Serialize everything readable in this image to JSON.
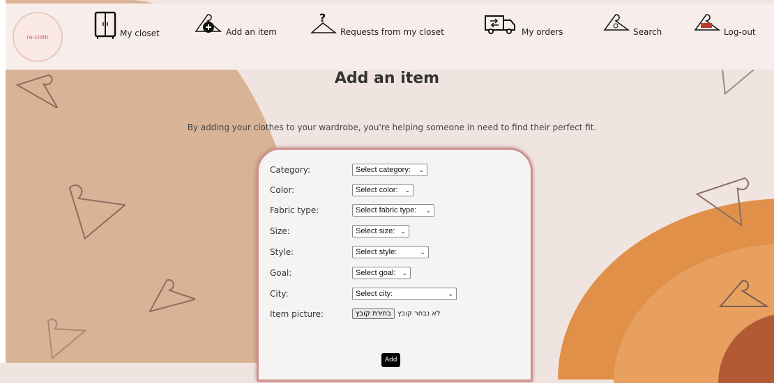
{
  "nav": {
    "logo_text": "re-cloth",
    "items": [
      {
        "label": "My closet",
        "icon": "closet-icon"
      },
      {
        "label": "Add an item",
        "icon": "hanger-plus-icon"
      },
      {
        "label": "Requests from my closet",
        "icon": "hanger-question-icon"
      },
      {
        "label": "My orders",
        "icon": "delivery-truck-icon"
      },
      {
        "label": "Search",
        "icon": "hanger-search-icon"
      },
      {
        "label": "Log-out",
        "icon": "hanger-exit-icon"
      }
    ]
  },
  "page": {
    "title": "Add an item",
    "subtitle": "By adding your clothes to your wardrobe, you're helping someone in need to find their perfect fit."
  },
  "form": {
    "category": {
      "label": "Category:",
      "value": "Select category:"
    },
    "color": {
      "label": "Color:",
      "value": "Select color:"
    },
    "fabric": {
      "label": "Fabric type:",
      "value": "Select fabric type:"
    },
    "size": {
      "label": "Size:",
      "value": "Select size:"
    },
    "style": {
      "label": "Style:",
      "value": "Select style:"
    },
    "goal": {
      "label": "Goal:",
      "value": "Select goal:"
    },
    "city": {
      "label": "City:",
      "value": "Select city:"
    },
    "picture": {
      "label": "Item picture:",
      "button": "בחירת קובץ",
      "status": "לא נבחר קובץ"
    },
    "submit": "Add"
  },
  "colors": {
    "accent": "#d09090",
    "brown": "#d9b396",
    "orange": "#e09048"
  }
}
